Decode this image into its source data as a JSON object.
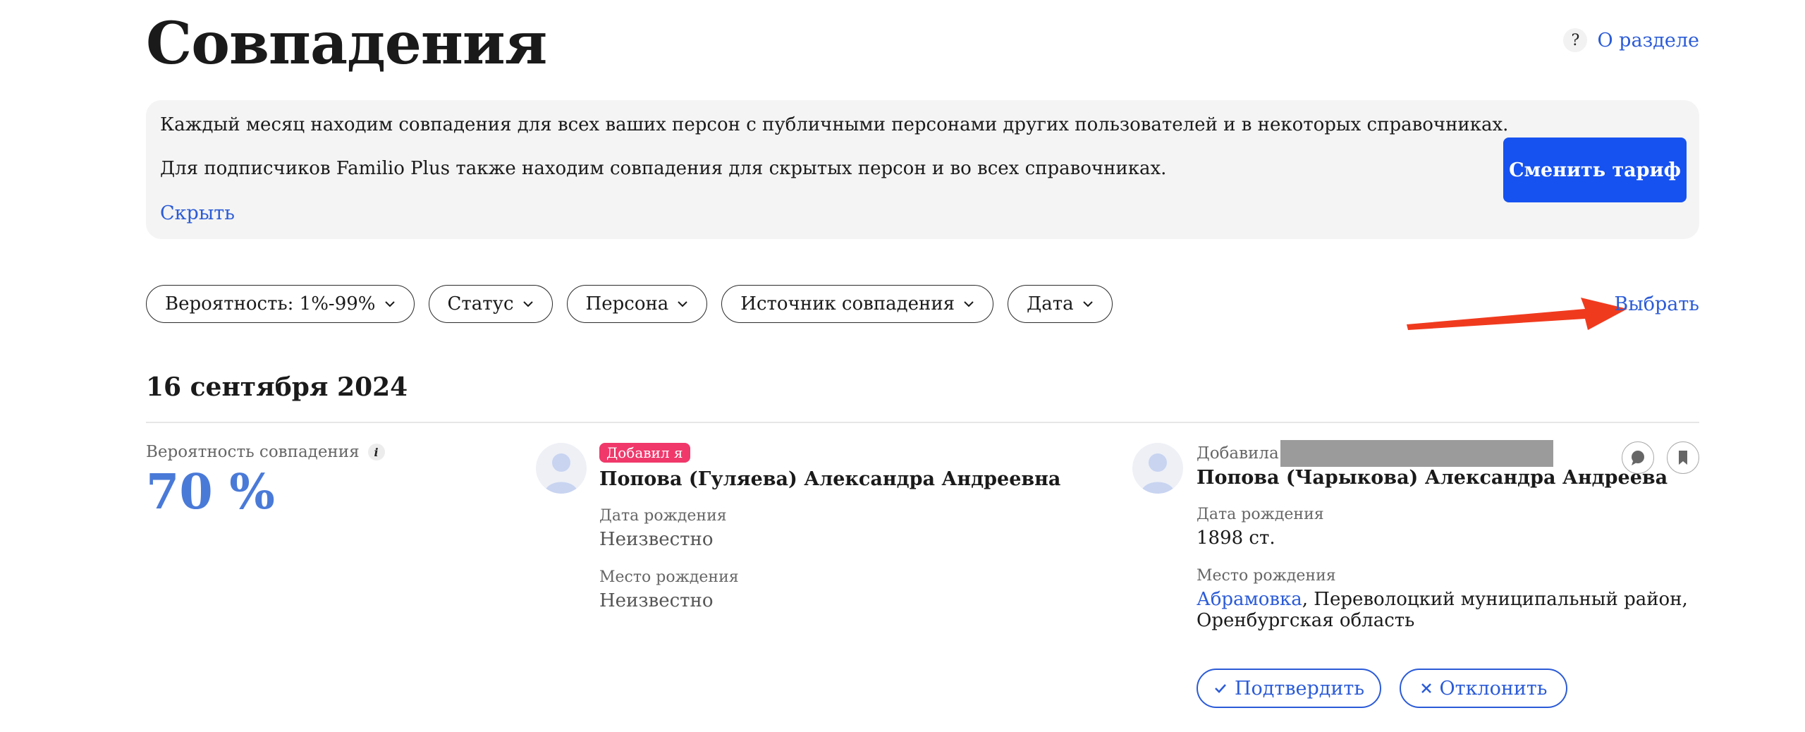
{
  "header": {
    "title": "Совпадения",
    "about_icon": "?",
    "about_label": "О разделе"
  },
  "banner": {
    "line1": "Каждый месяц находим совпадения для всех ваших персон с публичными персонами других пользователей и в некоторых справочниках.",
    "line2": "Для подписчиков Familio Plus также находим совпадения для скрытых персон и во всех справочниках.",
    "hide_label": "Скрыть",
    "tariff_button": "Сменить тариф"
  },
  "filters": {
    "items": [
      {
        "label": "Вероятность: 1%-99%"
      },
      {
        "label": "Статус"
      },
      {
        "label": "Персона"
      },
      {
        "label": "Источник совпадения"
      },
      {
        "label": "Дата"
      }
    ],
    "select_label": "Выбрать"
  },
  "group": {
    "date": "16 сентября 2024"
  },
  "match": {
    "probability_label": "Вероятность совпадения",
    "info_icon": "i",
    "probability_value": "70 %",
    "left": {
      "badge": "Добавил я",
      "name": "Попова (Гуляева) Александра Андреевна",
      "birth_date_label": "Дата рождения",
      "birth_date_value": "Неизвестно",
      "birth_place_label": "Место рождения",
      "birth_place_value": "Неизвестно"
    },
    "right": {
      "added_by_label": "Добавила",
      "name": "Попова (Чарыкова) Александра Андреева",
      "birth_date_label": "Дата рождения",
      "birth_date_value": "1898 ст.",
      "birth_place_label": "Место рождения",
      "birth_place_link": "Абрамовка",
      "birth_place_rest": ", Переволоцкий муниципальный район,",
      "birth_place_line2": "Оренбургская область"
    },
    "confirm_label": "Подтвердить",
    "reject_label": "Отклонить"
  },
  "colors": {
    "accent": "#2b5bd7",
    "primary_button": "#1652f0",
    "badge": "#f0386b",
    "probability": "#4a7ad8",
    "arrow": "#f03a1e"
  }
}
